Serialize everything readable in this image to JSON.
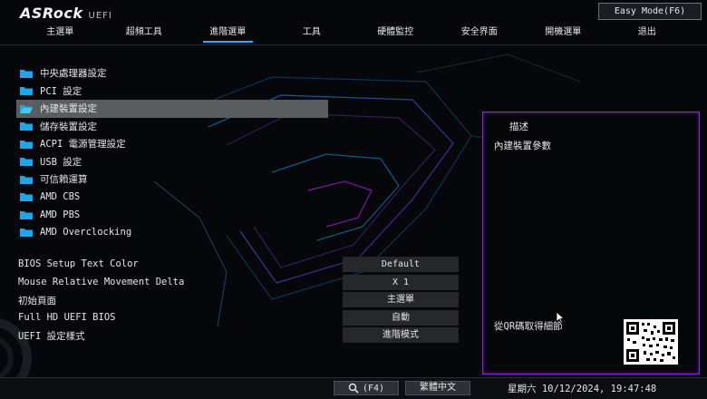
{
  "header": {
    "logo_text": "ASRock",
    "logo_sub": "UEFI",
    "easy_mode_label": "Easy Mode(F6)"
  },
  "tabs": [
    {
      "label": "主選單"
    },
    {
      "label": "超頻工具"
    },
    {
      "label": "進階選單",
      "active": true
    },
    {
      "label": "工具"
    },
    {
      "label": "硬體監控"
    },
    {
      "label": "安全界面"
    },
    {
      "label": "開機選單"
    },
    {
      "label": "退出"
    }
  ],
  "menu": {
    "items": [
      {
        "label": "中央處理器設定"
      },
      {
        "label": "PCI 設定"
      },
      {
        "label": "內建裝置設定",
        "selected": true
      },
      {
        "label": "儲存裝置設定"
      },
      {
        "label": "ACPI 電源管理設定"
      },
      {
        "label": "USB 設定"
      },
      {
        "label": "可信賴運算"
      },
      {
        "label": "AMD CBS"
      },
      {
        "label": "AMD PBS"
      },
      {
        "label": "AMD Overclocking"
      }
    ]
  },
  "settings": [
    {
      "label": "BIOS Setup Text Color",
      "value": "Default"
    },
    {
      "label": "Mouse Relative Movement Delta",
      "value": "X 1"
    },
    {
      "label": "初始頁面",
      "value": "主選單"
    },
    {
      "label": "Full HD UEFI BIOS",
      "value": "自動"
    },
    {
      "label": "UEFI 設定樣式",
      "value": "進階模式"
    }
  ],
  "description": {
    "title": "描述",
    "text": "內建裝置參數",
    "qr_text": "從QR碼取得細節"
  },
  "footer": {
    "search_label": "(F4)",
    "language_label": "繁體中文",
    "datetime": "星期六 10/12/2024, 19:47:48"
  },
  "colors": {
    "accent": "#2ea8ff",
    "panel_border": "#8a2bd6",
    "selected_bg": "#5a5d60",
    "folder": "#1fa6e6"
  }
}
